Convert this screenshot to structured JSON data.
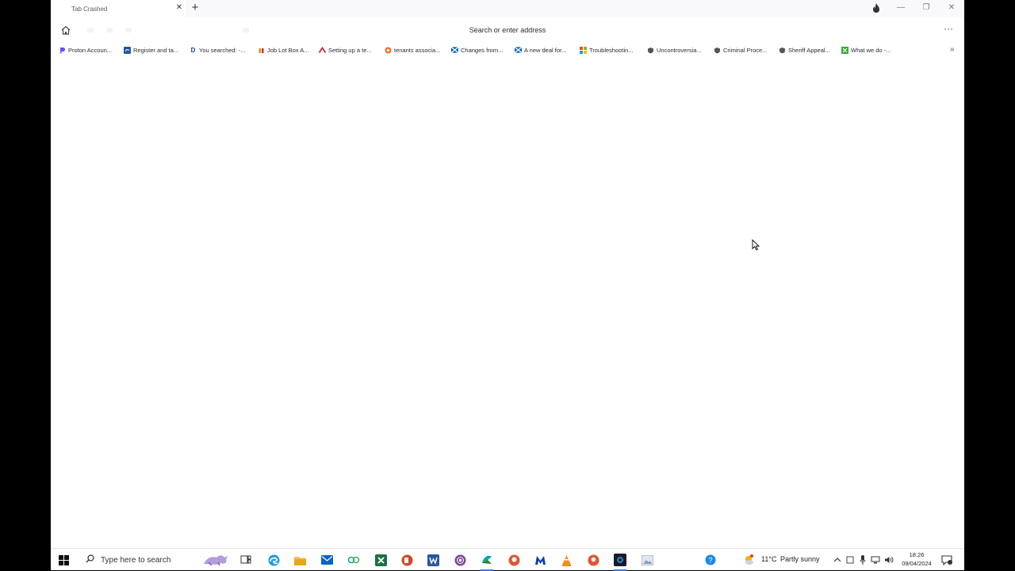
{
  "browser": {
    "tab": {
      "title": "Tab Crashed"
    },
    "address_bar": {
      "placeholder": "Search or enter address"
    },
    "bookmarks": [
      {
        "label": "Proton Accoun...",
        "icon": "proton-icon",
        "color": "#6d4aff"
      },
      {
        "label": "Register and ta...",
        "icon": "register-icon",
        "color": "#1c5aa6"
      },
      {
        "label": "You searched: -...",
        "icon": "d-icon",
        "color": "#1f3a93"
      },
      {
        "label": "Job Lot Box A...",
        "icon": "shop-icon",
        "color": "#c99a1b"
      },
      {
        "label": "Setting up a te...",
        "icon": "red-caret-icon",
        "color": "#d7263d"
      },
      {
        "label": "tenants associa...",
        "icon": "orange-circle-icon",
        "color": "#f06a1d"
      },
      {
        "label": "Changes from...",
        "icon": "saltire-icon",
        "color": "#0065bd"
      },
      {
        "label": "A new deal for...",
        "icon": "saltire-icon",
        "color": "#0065bd"
      },
      {
        "label": "Troubleshootin...",
        "icon": "microsoft-icon",
        "color": "#f25022"
      },
      {
        "label": "Uncontroversia...",
        "icon": "gray-shield-icon",
        "color": "#555555"
      },
      {
        "label": "Criminal Proce...",
        "icon": "gray-shield-icon",
        "color": "#555555"
      },
      {
        "label": "Sheriff Appeal...",
        "icon": "gray-shield-icon",
        "color": "#555555"
      },
      {
        "label": "What we do -...",
        "icon": "green-x-icon",
        "color": "#3aa635"
      }
    ]
  },
  "taskbar": {
    "search_placeholder": "Type here to search",
    "weather": {
      "temp": "11°C",
      "condition": "Partly sunny"
    },
    "clock": {
      "time": "18:26",
      "date": "09/04/2024"
    }
  }
}
